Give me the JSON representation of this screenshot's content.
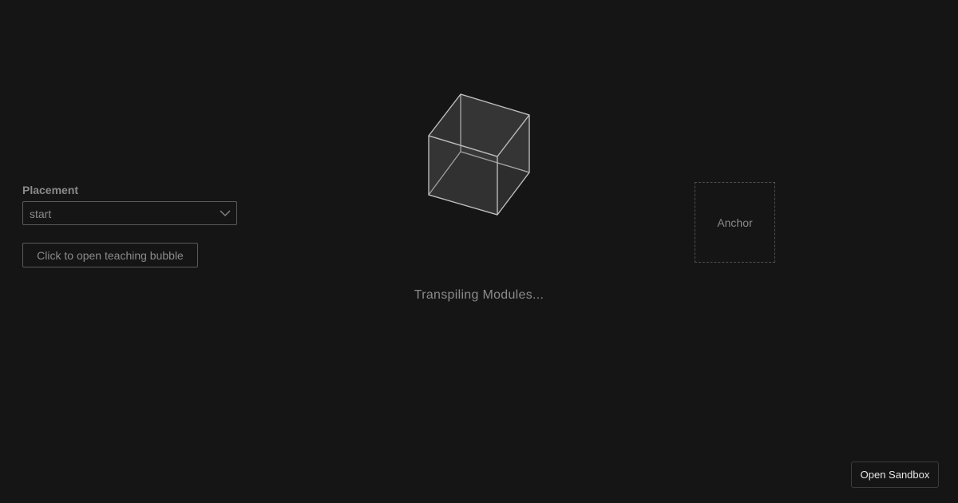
{
  "placement": {
    "label": "Placement",
    "selected_value": "start"
  },
  "teaching_bubble": {
    "button_label": "Click to open teaching bubble"
  },
  "loader": {
    "icon": "cube-icon",
    "text": "Transpiling Modules..."
  },
  "anchor": {
    "label": "Anchor"
  },
  "sandbox": {
    "button_label": "Open Sandbox"
  },
  "colors": {
    "background": "#151515",
    "muted_text": "#8a8a8a",
    "border": "#5a5a5a",
    "bright_text": "#e6e6e6"
  }
}
